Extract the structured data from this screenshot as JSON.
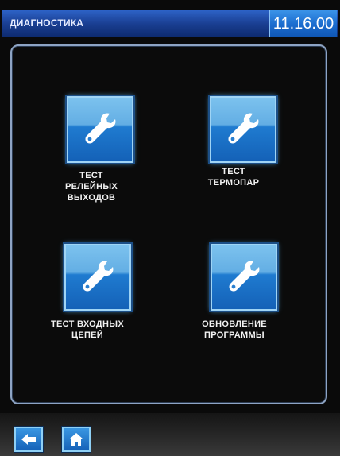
{
  "header": {
    "title": "ДИАГНОСТИКА",
    "clock": "11.16.00"
  },
  "tiles": [
    {
      "label": "ТЕСТ\nРЕЛЕЙНЫХ\nВЫХОДОВ",
      "icon": "wrench-icon"
    },
    {
      "label": "ТЕСТ\nТЕРМОПАР",
      "icon": "wrench-icon"
    },
    {
      "label": "ТЕСТ ВХОДНЫХ\nЦЕПЕЙ",
      "icon": "wrench-icon"
    },
    {
      "label": "ОБНОВЛЕНИЕ\nПРОГРАММЫ",
      "icon": "wrench-icon"
    }
  ],
  "bottom_bar": {
    "back_icon": "arrow-left-icon",
    "home_icon": "home-icon"
  },
  "colors": {
    "header_blue": "#1a3f92",
    "clock_blue": "#1c6ed0",
    "tile_blue": "#1f7bd0",
    "panel_border": "#8ea4c4"
  }
}
